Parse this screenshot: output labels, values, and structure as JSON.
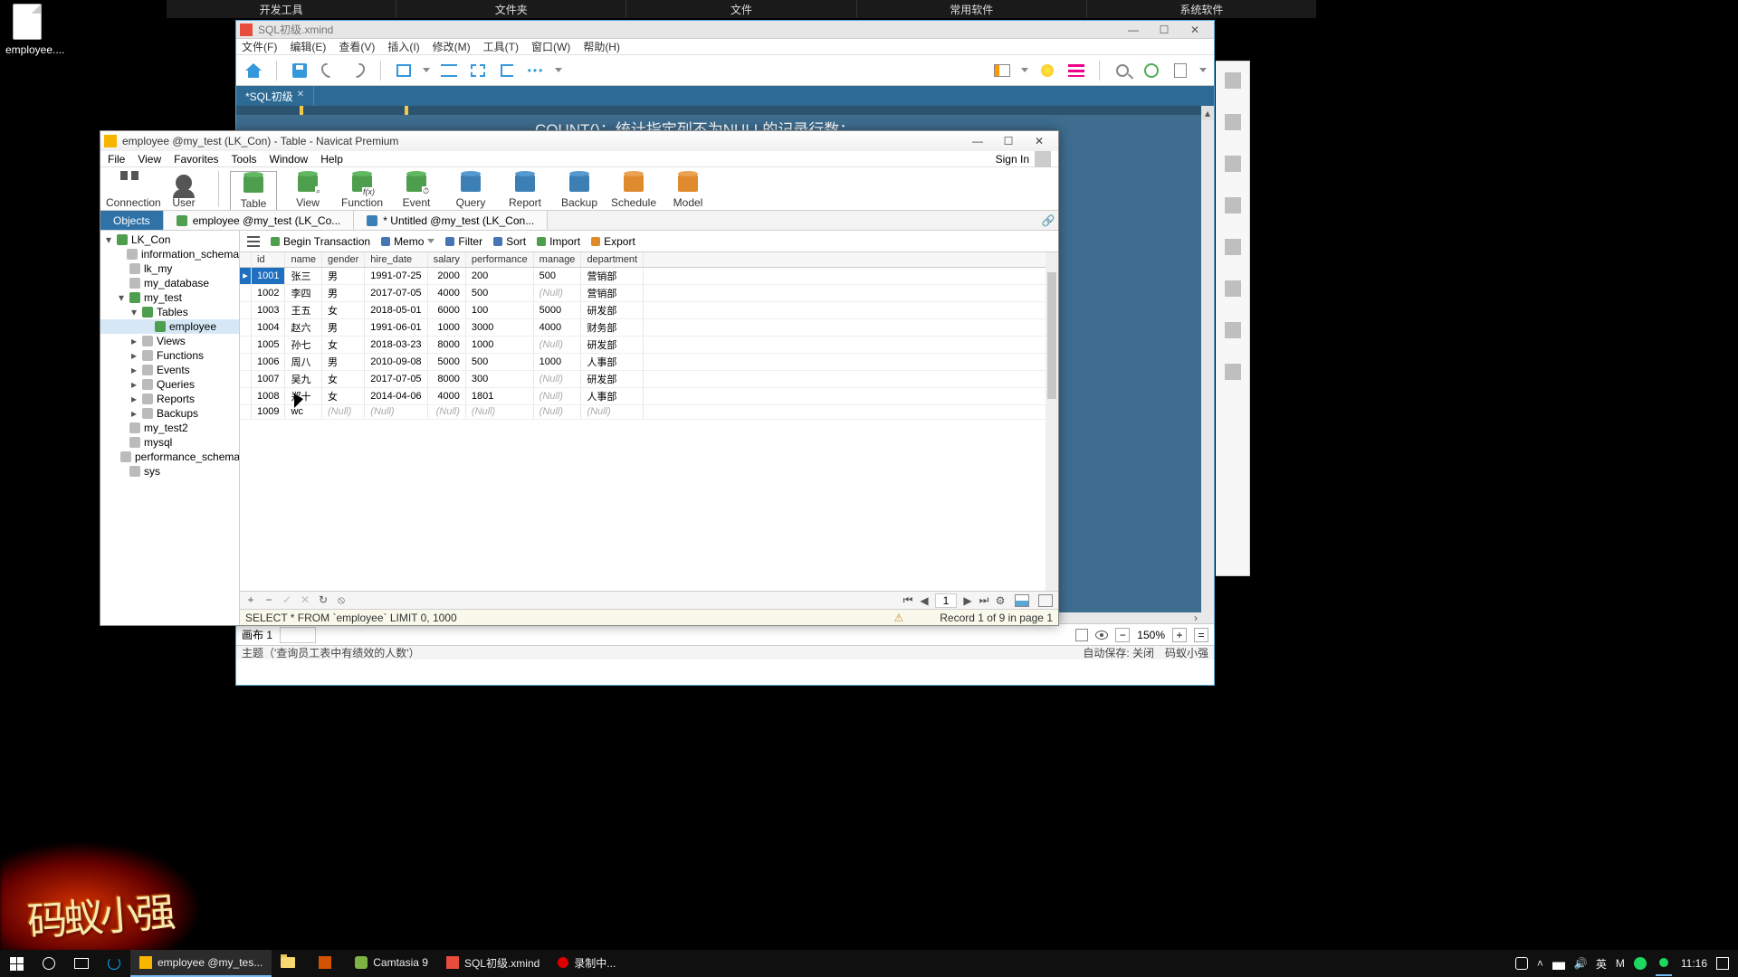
{
  "desktop": {
    "icon_label": "employee...."
  },
  "dock": {
    "items": [
      "开发工具",
      "文件夹",
      "文件",
      "常用软件",
      "系统软件"
    ]
  },
  "xmind": {
    "file": "SQL初级.xmind",
    "menu": [
      "文件(F)",
      "编辑(E)",
      "查看(V)",
      "插入(I)",
      "修改(M)",
      "工具(T)",
      "窗口(W)",
      "帮助(H)"
    ],
    "tab": "*SQL初级",
    "banner": "COUNT()：统计指定列不为NULL的记录行数；",
    "canvas_label": "画布 1",
    "zoom": "150%",
    "status_left": "主题（'查询员工表中有绩效的人数'）",
    "status_right1": "自动保存: 关闭",
    "status_right2": "码蚁小强"
  },
  "navicat": {
    "title": "employee @my_test (LK_Con) - Table - Navicat Premium",
    "menu": [
      "File",
      "View",
      "Favorites",
      "Tools",
      "Window",
      "Help"
    ],
    "signin": "Sign In",
    "toolbar": [
      "Connection",
      "User",
      "Table",
      "View",
      "Function",
      "Event",
      "Query",
      "Report",
      "Backup",
      "Schedule",
      "Model"
    ],
    "tabs": {
      "objects": "Objects",
      "t1": "employee @my_test (LK_Co...",
      "t2": "* Untitled @my_test (LK_Con..."
    },
    "actions": {
      "begin": "Begin Transaction",
      "memo": "Memo",
      "filter": "Filter",
      "sort": "Sort",
      "import": "Import",
      "export": "Export"
    },
    "tree": {
      "conn": "LK_Con",
      "dbs": [
        "information_schema",
        "lk_my",
        "my_database",
        "my_test"
      ],
      "my_test_children": {
        "tables": "Tables",
        "views": "Views",
        "functions": "Functions",
        "events": "Events",
        "queries": "Queries",
        "reports": "Reports",
        "backups": "Backups"
      },
      "table_item": "employee",
      "tail": [
        "my_test2",
        "mysql",
        "performance_schema",
        "sys"
      ]
    },
    "columns": [
      "id",
      "name",
      "gender",
      "hire_date",
      "salary",
      "performance",
      "manage",
      "department"
    ],
    "rows": [
      {
        "id": "1001",
        "name": "张三",
        "gender": "男",
        "hire_date": "1991-07-25",
        "salary": "2000",
        "performance": "200",
        "manage": "500",
        "department": "营销部"
      },
      {
        "id": "1002",
        "name": "李四",
        "gender": "男",
        "hire_date": "2017-07-05",
        "salary": "4000",
        "performance": "500",
        "manage": null,
        "department": "营销部"
      },
      {
        "id": "1003",
        "name": "王五",
        "gender": "女",
        "hire_date": "2018-05-01",
        "salary": "6000",
        "performance": "100",
        "manage": "5000",
        "department": "研发部"
      },
      {
        "id": "1004",
        "name": "赵六",
        "gender": "男",
        "hire_date": "1991-06-01",
        "salary": "1000",
        "performance": "3000",
        "manage": "4000",
        "department": "财务部"
      },
      {
        "id": "1005",
        "name": "孙七",
        "gender": "女",
        "hire_date": "2018-03-23",
        "salary": "8000",
        "performance": "1000",
        "manage": null,
        "department": "研发部"
      },
      {
        "id": "1006",
        "name": "周八",
        "gender": "男",
        "hire_date": "2010-09-08",
        "salary": "5000",
        "performance": "500",
        "manage": "1000",
        "department": "人事部"
      },
      {
        "id": "1007",
        "name": "吴九",
        "gender": "女",
        "hire_date": "2017-07-05",
        "salary": "8000",
        "performance": "300",
        "manage": null,
        "department": "研发部"
      },
      {
        "id": "1008",
        "name": "郑十",
        "gender": "女",
        "hire_date": "2014-04-06",
        "salary": "4000",
        "performance": "1801",
        "manage": null,
        "department": "人事部"
      },
      {
        "id": "1009",
        "name": "wc",
        "gender": null,
        "hire_date": null,
        "salary": null,
        "performance": null,
        "manage": null,
        "department": null
      }
    ],
    "gridfoot_page": "1",
    "sql": "SELECT * FROM `employee` LIMIT 0, 1000",
    "record": "Record 1 of 9 in page 1"
  },
  "watermark": "码蚁小强",
  "taskbar": {
    "tasks": [
      {
        "label": "employee @my_tes...",
        "active": true,
        "icon": "nav"
      },
      {
        "label": "",
        "icon": "folder"
      },
      {
        "label": "",
        "icon": "app"
      },
      {
        "label": "Camtasia 9",
        "icon": "cam"
      },
      {
        "label": "SQL初级.xmind",
        "icon": "xm"
      },
      {
        "label": "录制中...",
        "icon": "rec"
      }
    ],
    "ime1": "英",
    "ime2": "M",
    "time": "11:16"
  }
}
